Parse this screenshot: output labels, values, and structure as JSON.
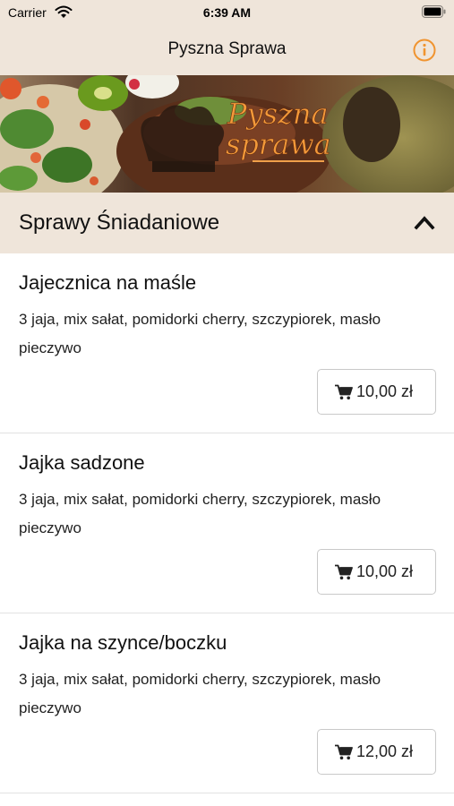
{
  "status": {
    "carrier": "Carrier",
    "time": "6:39 AM"
  },
  "nav": {
    "title": "Pyszna Sprawa",
    "info_icon": "info-circle-icon",
    "accent": "#f09430"
  },
  "hero": {
    "logo_line1": "Pyszna",
    "logo_line2": "sprawa"
  },
  "section": {
    "title": "Sprawy Śniadaniowe",
    "expanded": true,
    "icon": "chevron-up-icon"
  },
  "items": [
    {
      "name": "Jajecznica na maśle",
      "desc": "3 jaja, mix sałat, pomidorki cherry, szczypiorek, masło pieczywo",
      "price": "10,00 zł"
    },
    {
      "name": "Jajka sadzone",
      "desc": "3 jaja, mix sałat, pomidorki cherry, szczypiorek, masło pieczywo",
      "price": "10,00 zł"
    },
    {
      "name": "Jajka na szynce/boczku",
      "desc": "3 jaja, mix sałat, pomidorki cherry, szczypiorek, masło pieczywo",
      "price": "12,00 zł"
    }
  ],
  "colors": {
    "header_bg": "#efe5da",
    "divider": "#e2e2e2"
  }
}
